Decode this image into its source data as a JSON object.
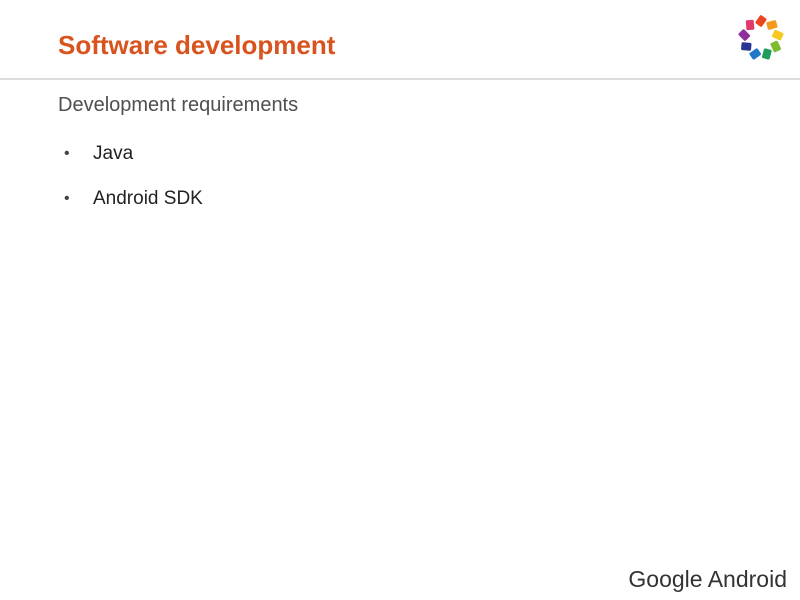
{
  "slide": {
    "title": "Software development",
    "subtitle": "Development requirements",
    "bullets": [
      "Java",
      "Android SDK"
    ],
    "footer": "Google Android"
  },
  "logo": {
    "icon": "pinwheel-logo-icon",
    "petal_colors": [
      "#e8471f",
      "#f39a1d",
      "#f7c81f",
      "#7dbb2f",
      "#1e9e5a",
      "#1f78c8",
      "#283593",
      "#8e2f9c",
      "#e23a6f"
    ]
  },
  "theme": {
    "title_color": "#d9531e",
    "rule_color": "#dcdcdc"
  }
}
